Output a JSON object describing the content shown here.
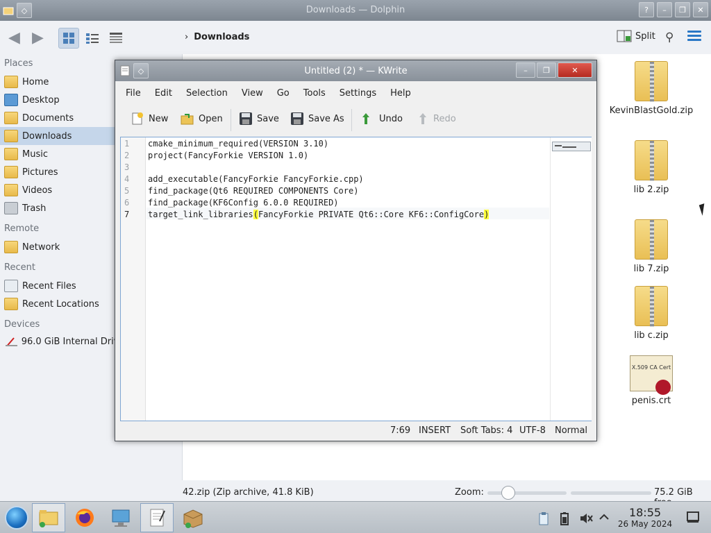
{
  "dolphin": {
    "title": "Downloads — Dolphin",
    "breadcrumb": "Downloads",
    "split_label": "Split",
    "places": {
      "places_header": "Places",
      "remote_header": "Remote",
      "recent_header": "Recent",
      "devices_header": "Devices",
      "items": {
        "home": "Home",
        "desktop": "Desktop",
        "documents": "Documents",
        "downloads": "Downloads",
        "music": "Music",
        "pictures": "Pictures",
        "videos": "Videos",
        "trash": "Trash",
        "network": "Network",
        "recent_files": "Recent Files",
        "recent_locations": "Recent Locations",
        "drive": "96.0 GiB Internal Drive"
      }
    },
    "files": [
      {
        "name": "KevinBlastGold.zip",
        "icon": "zip-archive-icon"
      },
      {
        "name": "lib 2.zip",
        "icon": "zip-archive-icon"
      },
      {
        "name": "lib 7.zip",
        "icon": "zip-archive-icon"
      },
      {
        "name": "lib c.zip",
        "icon": "zip-archive-icon"
      },
      {
        "name": "penis.crt",
        "icon": "certificate-icon"
      }
    ],
    "cert_icon_text": "X.509 CA Cert",
    "status": {
      "selection": "42.zip (Zip archive, 41.8 KiB)",
      "zoom_label": "Zoom:",
      "zoom_level": 0.2,
      "free_space": "75.2 GiB free"
    }
  },
  "kwrite": {
    "title": "Untitled (2) * — KWrite",
    "menu": [
      "File",
      "Edit",
      "Selection",
      "View",
      "Go",
      "Tools",
      "Settings",
      "Help"
    ],
    "toolbar": {
      "new": "New",
      "open": "Open",
      "save": "Save",
      "save_as": "Save As",
      "undo": "Undo",
      "redo": "Redo"
    },
    "lines": [
      {
        "num": "1",
        "text": "cmake_minimum_required(VERSION 3.10)"
      },
      {
        "num": "2",
        "text": "project(FancyForkie VERSION 1.0)"
      },
      {
        "num": "3",
        "text": ""
      },
      {
        "num": "4",
        "text": "add_executable(FancyForkie FancyForkie.cpp)"
      },
      {
        "num": "5",
        "text": "find_package(Qt6 REQUIRED COMPONENTS Core)"
      },
      {
        "num": "6",
        "text": "find_package(KF6Config 6.0.0 REQUIRED)"
      },
      {
        "num": "7",
        "text_pre": "target_link_libraries",
        "bracket_open": "(",
        "text_mid": "FancyForkie PRIVATE Qt6::Core KF6::ConfigCore",
        "bracket_close": ")"
      }
    ],
    "status": {
      "cursor_pos": "7:69",
      "mode": "INSERT",
      "indent": "Soft Tabs: 4",
      "encoding": "UTF-8",
      "syntax": "Normal"
    }
  },
  "taskbar": {
    "clock_time": "18:55",
    "clock_date": "26 May 2024"
  },
  "colors": {
    "selection": "#c5d6ea",
    "accent": "#2a78c6",
    "bracket_highlight": "#ffff3c"
  }
}
